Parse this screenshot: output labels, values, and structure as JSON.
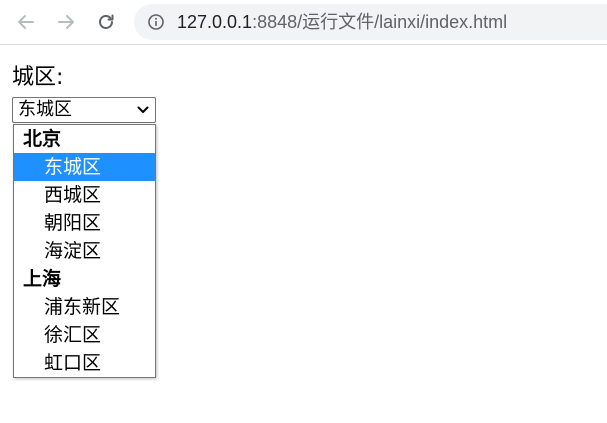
{
  "browser": {
    "url_host": "127.0.0.1",
    "url_path": ":8848/运行文件/lainxi/index.html"
  },
  "form": {
    "label": "城区:",
    "select_value": "东城区"
  },
  "dropdown": {
    "groups": [
      {
        "label": "北京",
        "options": [
          "东城区",
          "西城区",
          "朝阳区",
          "海淀区"
        ]
      },
      {
        "label": "上海",
        "options": [
          "浦东新区",
          "徐汇区",
          "虹口区"
        ]
      }
    ],
    "selected": "东城区"
  },
  "colors": {
    "highlight": "#1e90ff",
    "omnibox_bg": "#f1f3f4"
  },
  "icons": [
    "back-arrow-icon",
    "forward-arrow-icon",
    "reload-icon",
    "info-icon",
    "chevron-down-icon"
  ]
}
